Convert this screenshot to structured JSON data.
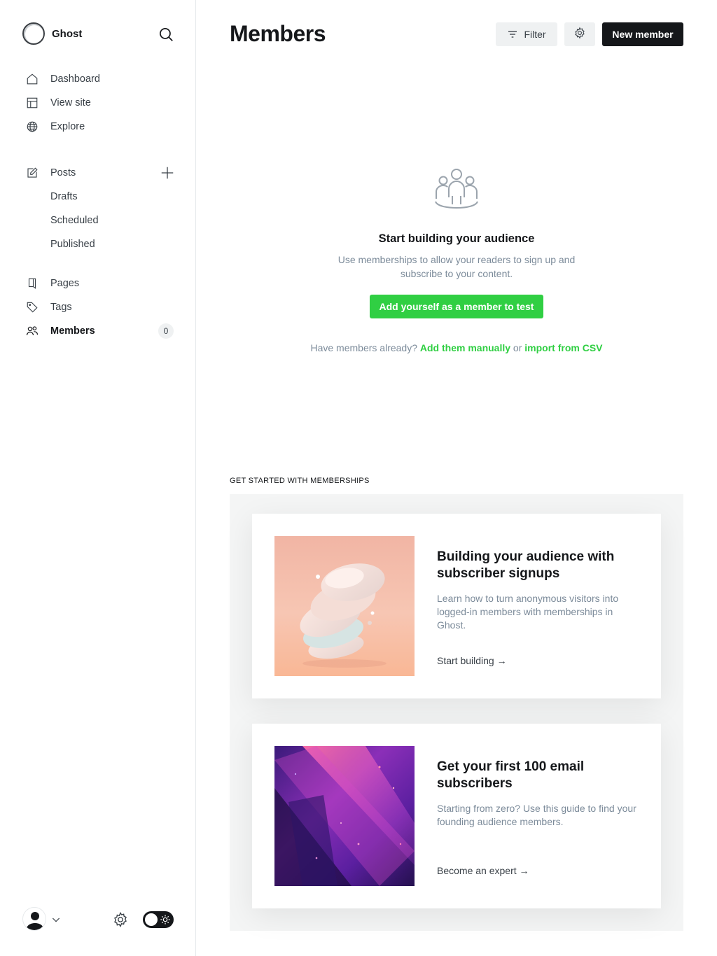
{
  "brand": {
    "name": "Ghost"
  },
  "sidebar": {
    "primary": [
      {
        "label": "Dashboard",
        "icon": "home-icon"
      },
      {
        "label": "View site",
        "icon": "layout-icon"
      },
      {
        "label": "Explore",
        "icon": "globe-icon"
      }
    ],
    "posts": {
      "label": "Posts",
      "sub": [
        "Drafts",
        "Scheduled",
        "Published"
      ]
    },
    "secondary": [
      {
        "label": "Pages",
        "icon": "page-icon"
      },
      {
        "label": "Tags",
        "icon": "tag-icon"
      },
      {
        "label": "Members",
        "icon": "members-icon",
        "count": "0",
        "active": true
      }
    ]
  },
  "header": {
    "title": "Members",
    "filter_label": "Filter",
    "new_label": "New member"
  },
  "empty_state": {
    "title": "Start building your audience",
    "description": "Use memberships to allow your readers to sign up and subscribe to your content.",
    "cta": "Add yourself as a member to test",
    "already_prefix": "Have members already?",
    "add_manually": "Add them manually",
    "or": "or",
    "import_csv": "import from CSV"
  },
  "get_started": {
    "label": "GET STARTED WITH MEMBERSHIPS",
    "cards": [
      {
        "title": "Building your audience with subscriber signups",
        "description": "Learn how to turn anonymous visitors into logged-in members with memberships in Ghost.",
        "link": "Start building →"
      },
      {
        "title": "Get your first 100 email subscribers",
        "description": "Starting from zero? Use this guide to find your founding audience members.",
        "link": "Become an expert →"
      }
    ]
  },
  "colors": {
    "accent_green": "#30cf43",
    "primary_dark": "#15171a",
    "muted_text": "#7c8b9a"
  }
}
